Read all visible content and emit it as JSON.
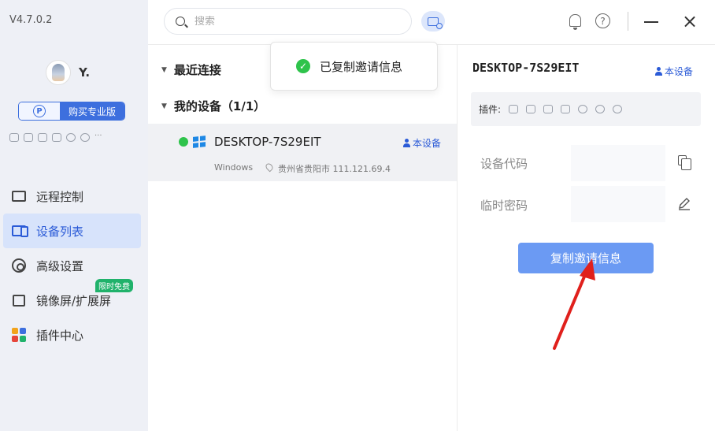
{
  "app": {
    "version": "V4.7.0.2"
  },
  "user": {
    "name": "Y."
  },
  "sidebar": {
    "buy_pro_label": "购买专业版",
    "pro_badge": "P",
    "more_plugins": "···",
    "nav": [
      {
        "label": "远程控制"
      },
      {
        "label": "设备列表"
      },
      {
        "label": "高级设置"
      },
      {
        "label": "镜像屏/扩展屏",
        "badge": "限时免费"
      },
      {
        "label": "插件中心"
      }
    ]
  },
  "topbar": {
    "search_placeholder": "搜索",
    "help_glyph": "?"
  },
  "device_list": {
    "recent_label": "最近连接",
    "my_devices_label": "我的设备（1/1）",
    "device": {
      "name": "DESKTOP-7S29EIT",
      "this_device": "本设备",
      "os": "Windows",
      "location": "贵州省贵阳市 111.121.69.4"
    }
  },
  "toast": {
    "text": "已复制邀请信息"
  },
  "detail": {
    "title": "DESKTOP-7S29EIT",
    "this_device": "本设备",
    "plugins_label": "插件:",
    "device_code_label": "设备代码",
    "temp_password_label": "临时密码",
    "copy_invite_button": "复制邀请信息"
  },
  "colors": {
    "accent": "#3d6fde",
    "online": "#2ec34b",
    "button": "#6b9af3",
    "badge_green": "#20b26b",
    "arrow": "#e0201c"
  }
}
